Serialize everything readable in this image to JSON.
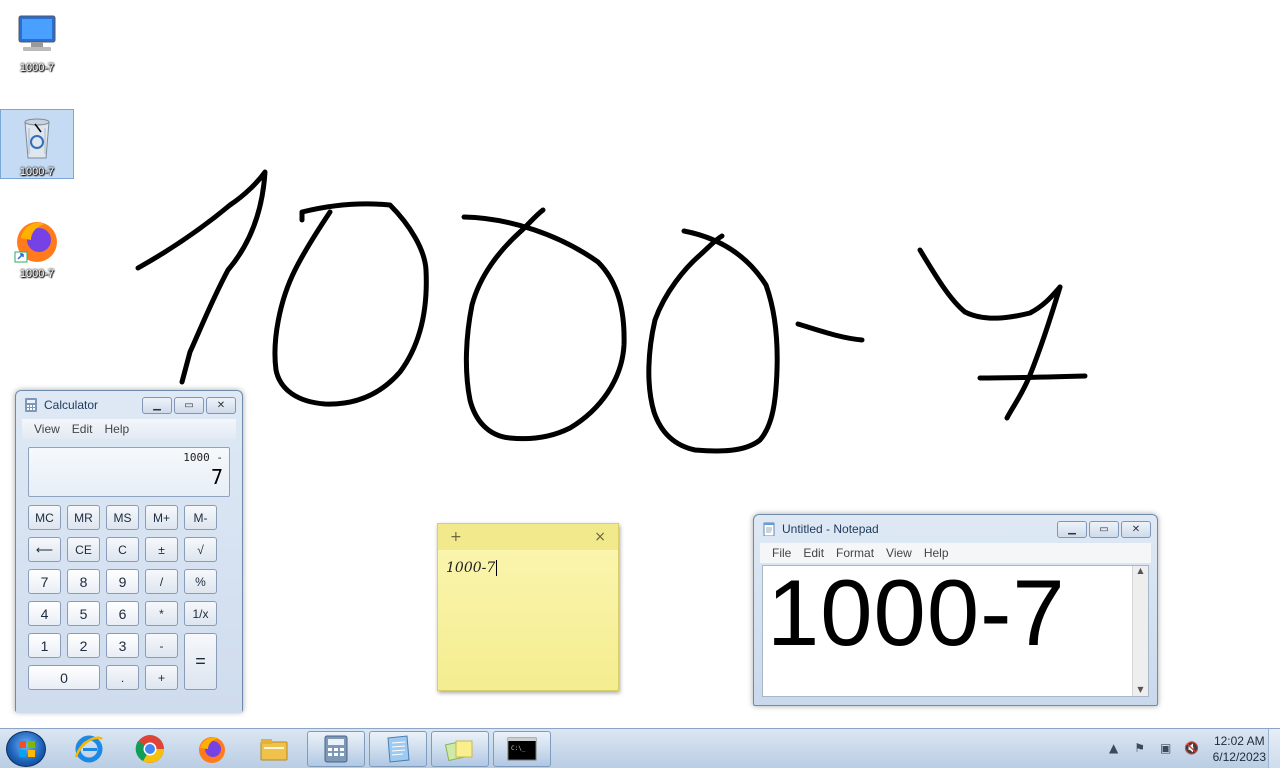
{
  "desktop": {
    "icons": [
      {
        "label": "1000-7",
        "icon": "computer-icon"
      },
      {
        "label": "1000-7",
        "icon": "recycle-bin-icon"
      },
      {
        "label": "1000-7",
        "icon": "firefox-icon"
      }
    ],
    "drawing_text": "1000-7"
  },
  "calculator": {
    "title": "Calculator",
    "menu": [
      "View",
      "Edit",
      "Help"
    ],
    "display_expression": "1000 -",
    "display_value": "7",
    "keys": [
      "MC",
      "MR",
      "MS",
      "M+",
      "M-",
      "⟵",
      "CE",
      "C",
      "±",
      "√",
      "7",
      "8",
      "9",
      "/",
      "%",
      "4",
      "5",
      "6",
      "*",
      "1/x",
      "1",
      "2",
      "3",
      "-",
      "=",
      "0",
      ".",
      "+"
    ]
  },
  "sticky": {
    "add_label": "+",
    "close_label": "×",
    "text": "1000-7"
  },
  "notepad": {
    "title": "Untitled - Notepad",
    "menu": [
      "File",
      "Edit",
      "Format",
      "View",
      "Help"
    ],
    "content": "1000-7"
  },
  "taskbar": {
    "pinned": [
      "internet-explorer-icon",
      "chrome-icon",
      "firefox-icon",
      "file-explorer-icon",
      "calculator-icon",
      "notepad-icon",
      "sticky-notes-icon",
      "command-prompt-icon"
    ],
    "time": "12:02 AM",
    "date": "6/12/2023"
  },
  "colors": {
    "accent": "#1e395b",
    "sticky": "#f7f0a0",
    "taskbar": "#c9d9ec"
  }
}
